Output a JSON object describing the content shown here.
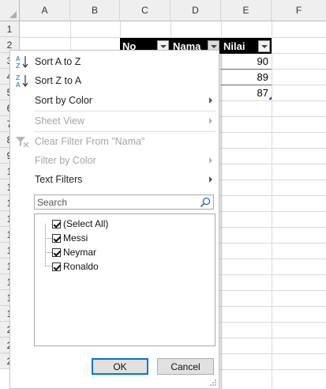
{
  "columns": [
    "A",
    "B",
    "C",
    "D",
    "E",
    "F"
  ],
  "rows": [
    "1",
    "2",
    "3",
    "4",
    "5",
    "6",
    "7",
    "8",
    "9",
    "1",
    "1",
    "1",
    "1",
    "1",
    "1",
    "1",
    "1",
    "1",
    "1",
    "2",
    "2",
    "2"
  ],
  "table": {
    "headers": [
      "No",
      "Nama",
      "Nilai"
    ],
    "values": [
      "90",
      "89",
      "87"
    ]
  },
  "menu": {
    "sort_az": "Sort A to Z",
    "sort_za": "Sort Z to A",
    "sort_color": "Sort by Color",
    "sheet_view": "Sheet View",
    "clear_filter": "Clear Filter From \"Nama\"",
    "filter_color": "Filter by Color",
    "text_filters": "Text Filters",
    "search_placeholder": "Search",
    "items": [
      "(Select All)",
      "Messi",
      "Neymar",
      "Ronaldo"
    ],
    "ok": "OK",
    "cancel": "Cancel"
  },
  "colors": {
    "header_bg": "#000000",
    "header_text": "#ffffff",
    "ok_border": "#0078d7",
    "disabled_text": "#a6a6a6"
  }
}
